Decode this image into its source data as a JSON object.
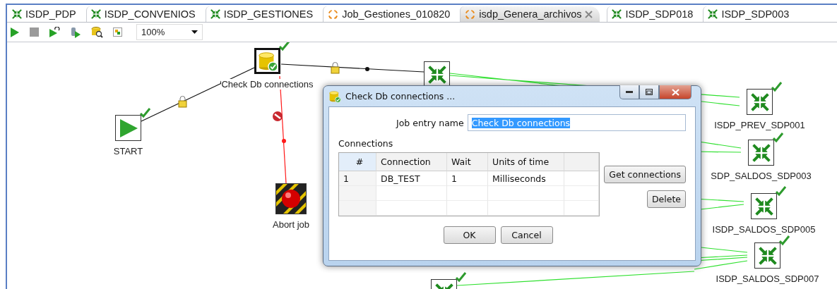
{
  "tabs": [
    {
      "label": "ISDP_PDP",
      "kind": "transformation",
      "selected": false
    },
    {
      "label": "ISDP_CONVENIOS",
      "kind": "transformation",
      "selected": false
    },
    {
      "label": "ISDP_GESTIONES",
      "kind": "transformation",
      "selected": false
    },
    {
      "label": "Job_Gestiones_010820",
      "kind": "job",
      "selected": false
    },
    {
      "label": "isdp_Genera_archivos",
      "kind": "job",
      "selected": true
    },
    {
      "label": "ISDP_SDP018",
      "kind": "transformation",
      "selected": false
    },
    {
      "label": "ISDP_SDP003",
      "kind": "transformation",
      "selected": false
    }
  ],
  "toolbar": {
    "zoom": "100%"
  },
  "canvas": {
    "nodes": [
      {
        "label": "START",
        "kind": "start",
        "done": true
      },
      {
        "label": "Check Db connections",
        "kind": "check_db",
        "done": true
      },
      {
        "label": "Abort job",
        "kind": "abort",
        "done": false
      },
      {
        "kind": "transformation",
        "done": false
      },
      {
        "label": "ISDP_PREV_SDP001",
        "kind": "transformation",
        "done": true
      },
      {
        "label": "SDP_SALDOS_SDP003",
        "kind": "transformation",
        "done": true
      },
      {
        "label": "ISDP_SALDOS_SDP005",
        "kind": "transformation",
        "done": true
      },
      {
        "label": "ISDP_SALDOS_SDP007",
        "kind": "transformation",
        "done": true
      },
      {
        "kind": "transformation",
        "done": true
      }
    ],
    "hops": [
      {
        "kind": "unconditional"
      },
      {
        "kind": "unconditional"
      },
      {
        "kind": "failure"
      },
      {
        "kind": "success"
      },
      {
        "kind": "success"
      },
      {
        "kind": "success"
      },
      {
        "kind": "success"
      },
      {
        "kind": "success"
      },
      {
        "kind": "success"
      }
    ]
  },
  "dialog": {
    "title": "Check Db connections ...",
    "name_label": "Job entry name",
    "name_value": "Check Db connections",
    "connections_label": "Connections",
    "columns": [
      "#",
      "Connection",
      "Wait",
      "Units of time"
    ],
    "rows": [
      [
        "1",
        "DB_TEST",
        "1",
        "Milliseconds"
      ]
    ],
    "side_buttons": [
      "Get connections",
      "Delete"
    ],
    "buttons": [
      "OK",
      "Cancel"
    ]
  }
}
